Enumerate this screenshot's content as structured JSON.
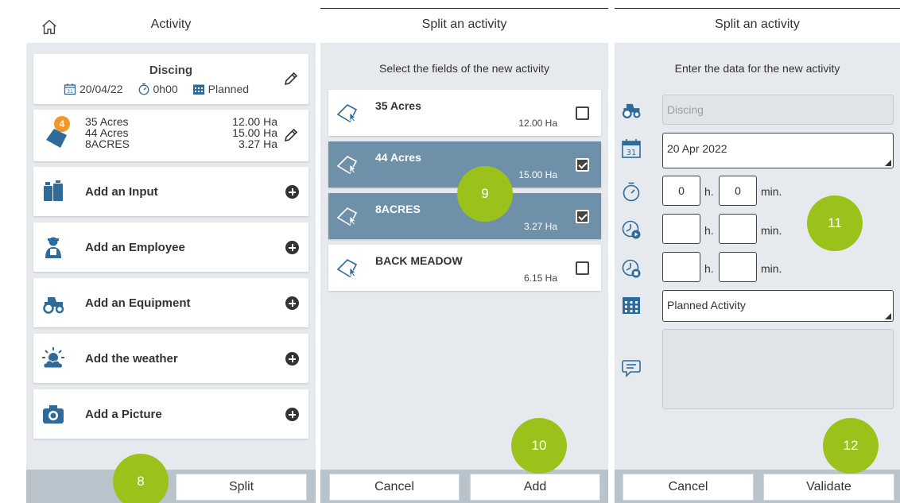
{
  "panel1": {
    "title": "Activity",
    "summary": {
      "name": "Discing",
      "date": "20/04/22",
      "duration": "0h00",
      "status": "Planned"
    },
    "fields": {
      "count": "4",
      "rows": [
        {
          "name": "35 Acres",
          "area": "12.00 Ha"
        },
        {
          "name": "44 Acres",
          "area": "15.00 Ha"
        },
        {
          "name": "8ACRES",
          "area": "3.27 Ha"
        }
      ]
    },
    "add_items": [
      {
        "label": "Add an Input",
        "icon": "input-jerrycan-icon"
      },
      {
        "label": "Add an Employee",
        "icon": "employee-icon"
      },
      {
        "label": "Add an Equipment",
        "icon": "tractor-icon"
      },
      {
        "label": "Add the weather",
        "icon": "weather-icon"
      },
      {
        "label": "Add a Picture",
        "icon": "camera-icon"
      }
    ],
    "split_label": "Split",
    "marker": "8"
  },
  "panel2": {
    "title": "Split an activity",
    "instruction": "Select the fields of the new activity",
    "fields": [
      {
        "name": "35 Acres",
        "area": "12.00 Ha",
        "checked": false
      },
      {
        "name": "44 Acres",
        "area": "15.00 Ha",
        "checked": true
      },
      {
        "name": "8ACRES",
        "area": "3.27 Ha",
        "checked": true
      },
      {
        "name": "BACK MEADOW",
        "area": "6.15 Ha",
        "checked": false
      }
    ],
    "cancel_label": "Cancel",
    "add_label": "Add",
    "marker_fields": "9",
    "marker_add": "10"
  },
  "panel3": {
    "title": "Split an activity",
    "instruction": "Enter the data for the new activity",
    "activity_placeholder": "Discing",
    "date": "20 Apr 2022",
    "duration_h": "0",
    "duration_min": "0",
    "unit_h": "h.",
    "unit_min": "min.",
    "status": "Planned Activity",
    "cancel_label": "Cancel",
    "validate_label": "Validate",
    "marker_form": "11",
    "marker_validate": "12"
  },
  "colors": {
    "selected": "#6e90a8",
    "marker": "#9bc21b",
    "badge": "#f0962a",
    "icon_blue": "#2f6b9a",
    "body_bg": "#e6e9ee"
  }
}
